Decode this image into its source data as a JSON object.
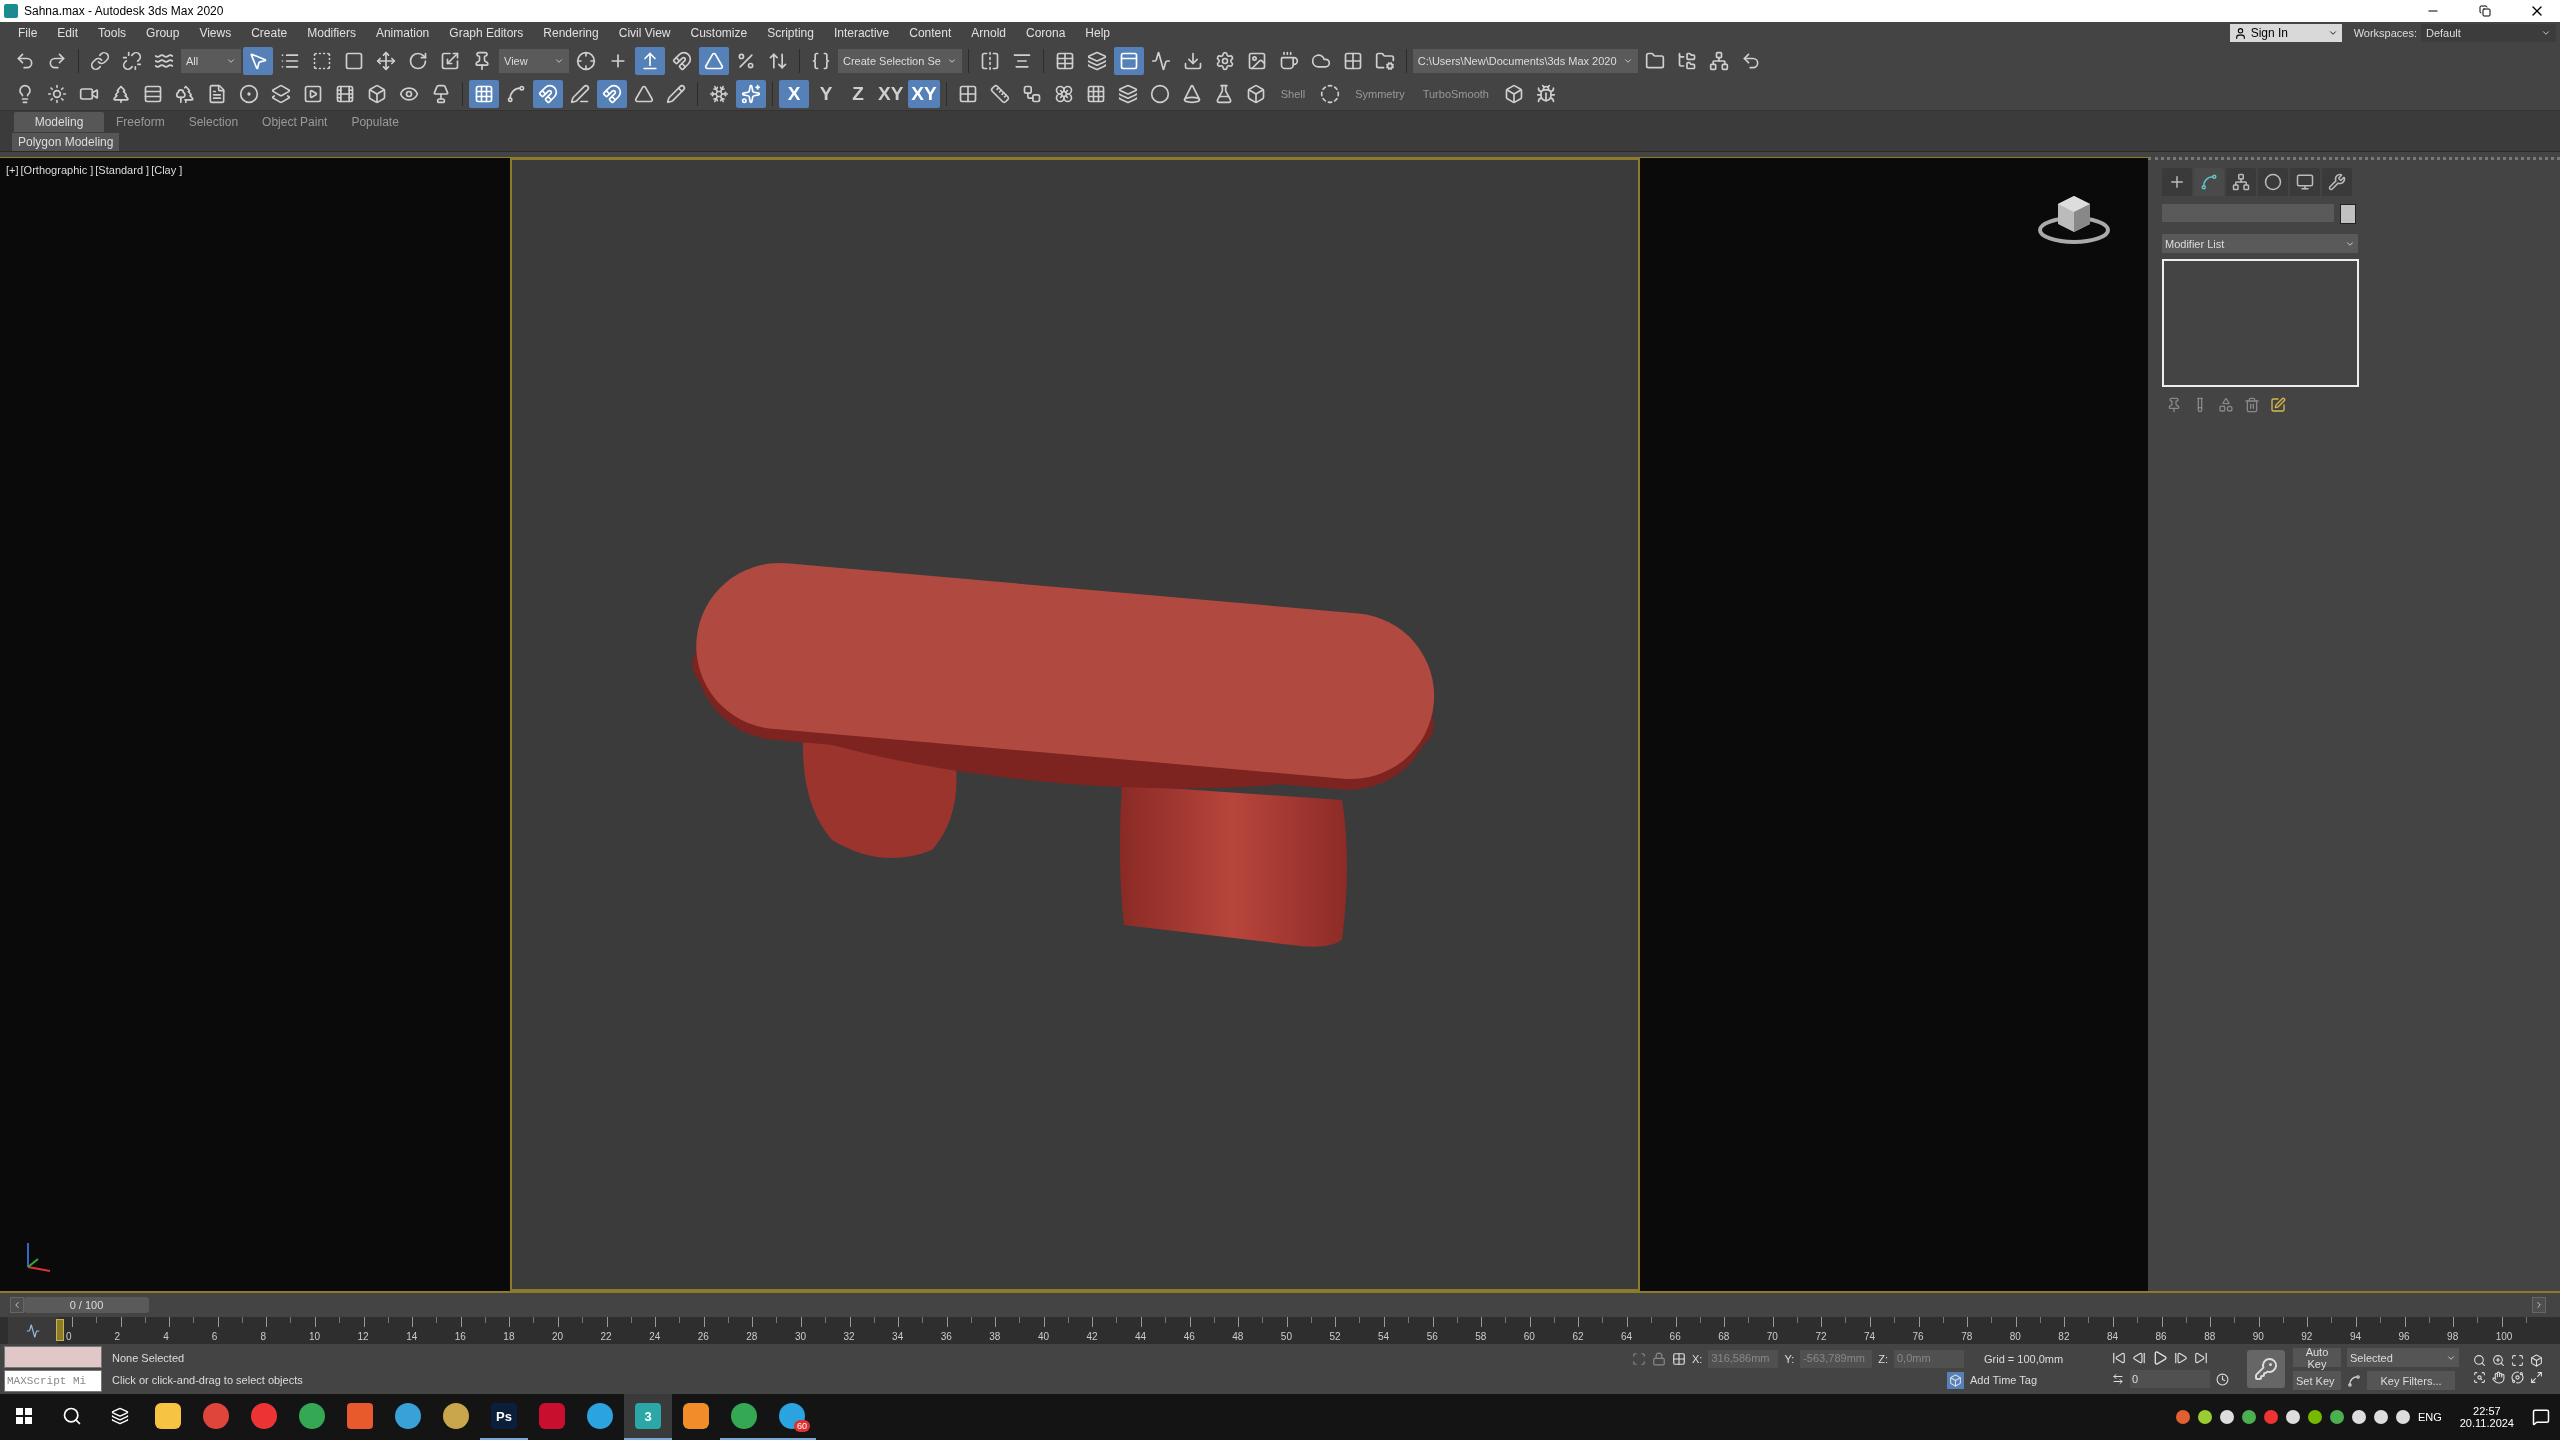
{
  "window": {
    "title": "Sahna.max - Autodesk 3ds Max 2020"
  },
  "menu": [
    "File",
    "Edit",
    "Tools",
    "Group",
    "Views",
    "Create",
    "Modifiers",
    "Animation",
    "Graph Editors",
    "Rendering",
    "Civil View",
    "Customize",
    "Scripting",
    "Interactive",
    "Content",
    "Arnold",
    "Corona",
    "Help"
  ],
  "account": {
    "sign_in": "Sign In",
    "workspaces_label": "Workspaces:",
    "workspace": "Default"
  },
  "toolbar_main": [
    {
      "kind": "icon",
      "selected": false
    },
    {
      "kind": "icon",
      "selected": false
    },
    {
      "kind": "sep"
    },
    {
      "kind": "icon",
      "selected": false
    },
    {
      "kind": "icon",
      "selected": false
    },
    {
      "kind": "icon",
      "selected": false
    },
    {
      "kind": "dropdown",
      "value": "All"
    },
    {
      "kind": "icon",
      "selected": true
    },
    {
      "kind": "icon",
      "selected": false
    },
    {
      "kind": "icon",
      "selected": false
    },
    {
      "kind": "icon",
      "selected": false
    },
    {
      "kind": "icon",
      "selected": false
    },
    {
      "kind": "icon",
      "selected": false
    },
    {
      "kind": "icon",
      "selected": false
    },
    {
      "kind": "icon",
      "selected": false
    },
    {
      "kind": "dropdown",
      "value": "View"
    },
    {
      "kind": "icon",
      "selected": false
    },
    {
      "kind": "icon",
      "selected": false
    },
    {
      "kind": "icon",
      "selected": true
    },
    {
      "kind": "icon",
      "selected": false
    },
    {
      "kind": "icon",
      "selected": true
    },
    {
      "kind": "icon",
      "selected": false
    },
    {
      "kind": "icon",
      "selected": false
    },
    {
      "kind": "sep"
    },
    {
      "kind": "icon",
      "selected": false
    },
    {
      "kind": "dropdown",
      "value": "Create Selection Se"
    },
    {
      "kind": "sep"
    },
    {
      "kind": "icon",
      "selected": false
    },
    {
      "kind": "icon",
      "selected": false
    },
    {
      "kind": "sep"
    },
    {
      "kind": "icon",
      "selected": false
    },
    {
      "kind": "icon",
      "selected": false
    },
    {
      "kind": "icon",
      "selected": true
    },
    {
      "kind": "icon",
      "selected": false
    },
    {
      "kind": "icon",
      "selected": false
    },
    {
      "kind": "icon",
      "selected": false
    },
    {
      "kind": "icon",
      "selected": false
    },
    {
      "kind": "icon",
      "selected": false
    },
    {
      "kind": "icon",
      "selected": false
    },
    {
      "kind": "icon",
      "selected": false
    },
    {
      "kind": "icon",
      "selected": false
    },
    {
      "kind": "sep"
    },
    {
      "kind": "dropdown",
      "value": "C:\\Users\\New\\Documents\\3ds Max 2020"
    },
    {
      "kind": "icon",
      "selected": false
    },
    {
      "kind": "icon",
      "selected": false
    },
    {
      "kind": "icon",
      "selected": false
    },
    {
      "kind": "icon",
      "selected": false
    }
  ],
  "toolbar_secondary": [
    {
      "kind": "icon",
      "selected": false
    },
    {
      "kind": "icon",
      "selected": false
    },
    {
      "kind": "icon",
      "selected": false
    },
    {
      "kind": "icon",
      "selected": false
    },
    {
      "kind": "icon",
      "selected": false
    },
    {
      "kind": "icon",
      "selected": false
    },
    {
      "kind": "icon",
      "selected": false
    },
    {
      "kind": "icon",
      "selected": false
    },
    {
      "kind": "icon",
      "selected": false
    },
    {
      "kind": "icon",
      "selected": false
    },
    {
      "kind": "icon",
      "selected": false
    },
    {
      "kind": "icon",
      "selected": false
    },
    {
      "kind": "icon",
      "selected": false
    },
    {
      "kind": "icon",
      "selected": false
    },
    {
      "kind": "sep"
    },
    {
      "kind": "icon",
      "selected": true
    },
    {
      "kind": "icon",
      "selected": false
    },
    {
      "kind": "icon",
      "selected": true
    },
    {
      "kind": "icon",
      "selected": false
    },
    {
      "kind": "icon",
      "selected": true
    },
    {
      "kind": "icon",
      "selected": false
    },
    {
      "kind": "icon",
      "selected": false
    },
    {
      "kind": "sep"
    },
    {
      "kind": "icon",
      "selected": false
    },
    {
      "kind": "icon",
      "selected": true
    },
    {
      "kind": "sep"
    },
    {
      "kind": "text",
      "label": "X",
      "selected": true
    },
    {
      "kind": "text",
      "label": "Y",
      "selected": false
    },
    {
      "kind": "text",
      "label": "Z",
      "selected": false
    },
    {
      "kind": "text",
      "label": "XY",
      "selected": false
    },
    {
      "kind": "text",
      "label": "XY",
      "selected": true
    },
    {
      "kind": "sep"
    },
    {
      "kind": "icon",
      "selected": false
    },
    {
      "kind": "icon",
      "selected": false
    },
    {
      "kind": "icon",
      "selected": false
    },
    {
      "kind": "icon",
      "selected": false
    },
    {
      "kind": "icon",
      "selected": false
    },
    {
      "kind": "icon",
      "selected": false
    },
    {
      "kind": "icon",
      "selected": false
    },
    {
      "kind": "icon",
      "selected": false
    },
    {
      "kind": "icon",
      "selected": false
    },
    {
      "kind": "icon",
      "selected": false
    },
    {
      "kind": "label",
      "label": "Shell"
    },
    {
      "kind": "icon",
      "selected": false
    },
    {
      "kind": "label",
      "label": "Symmetry"
    },
    {
      "kind": "label",
      "label": "TurboSmooth"
    },
    {
      "kind": "icon",
      "selected": false
    },
    {
      "kind": "icon",
      "selected": false
    }
  ],
  "ribbon": {
    "tabs": [
      {
        "label": "Modeling",
        "selected": true
      },
      {
        "label": "Freeform",
        "selected": false
      },
      {
        "label": "Selection",
        "selected": false
      },
      {
        "label": "Object Paint",
        "selected": false
      },
      {
        "label": "Populate",
        "selected": false
      }
    ],
    "panel": "Polygon Modeling"
  },
  "viewport": {
    "labels": [
      "[+]",
      "[Orthographic ]",
      "[Standard ]",
      "[Clay ]"
    ]
  },
  "command_panel": {
    "tabs": [
      {
        "selected": false
      },
      {
        "selected": true
      },
      {
        "selected": false
      },
      {
        "selected": false
      },
      {
        "selected": false
      },
      {
        "selected": false
      }
    ],
    "modifier_list": "Modifier List"
  },
  "time_slider": {
    "position": "0 / 100",
    "level": 0
  },
  "timeline": {
    "ticks": [
      "0",
      "2",
      "4",
      "6",
      "8",
      "10",
      "12",
      "14",
      "16",
      "18",
      "20",
      "22",
      "24",
      "26",
      "28",
      "30",
      "32",
      "34",
      "36",
      "38",
      "40",
      "42",
      "44",
      "46",
      "48",
      "50",
      "52",
      "54",
      "56",
      "58",
      "60",
      "62",
      "64",
      "66",
      "68",
      "70",
      "72",
      "74",
      "76",
      "78",
      "80",
      "82",
      "84",
      "86",
      "88",
      "90",
      "92",
      "94",
      "96",
      "98",
      "100"
    ]
  },
  "status": {
    "listener_placeholder": "MAXScript Mi",
    "selection": "None Selected",
    "prompt": "Click or click-and-drag to select objects",
    "x_label": "X:",
    "x": "316,586mm",
    "y_label": "Y:",
    "y": "-563,789mm",
    "z_label": "Z:",
    "z": "0,0mm",
    "grid": "Grid = 100,0mm",
    "add_time_tag": "Add Time Tag",
    "auto_key": "Auto Key",
    "key_mode": "Selected",
    "set_key": "Set Key",
    "key_filters": "Key Filters...",
    "frame": "0"
  },
  "taskbar": {
    "apps": [
      {
        "running": false,
        "selected": false
      },
      {
        "running": false,
        "selected": false
      },
      {
        "running": false,
        "selected": false
      },
      {
        "running": false,
        "selected": false
      },
      {
        "running": false,
        "selected": false
      },
      {
        "running": false,
        "selected": false
      },
      {
        "running": false,
        "selected": false
      },
      {
        "running": true,
        "selected": false,
        "label": "Ps"
      },
      {
        "running": false,
        "selected": false
      },
      {
        "running": false,
        "selected": false
      },
      {
        "running": true,
        "selected": true,
        "label": "3"
      },
      {
        "running": false,
        "selected": false
      },
      {
        "running": true,
        "selected": false
      },
      {
        "running": true,
        "selected": false,
        "badge": "60"
      }
    ],
    "language": "ENG",
    "time": "22:57",
    "date": "20.11.2024"
  }
}
